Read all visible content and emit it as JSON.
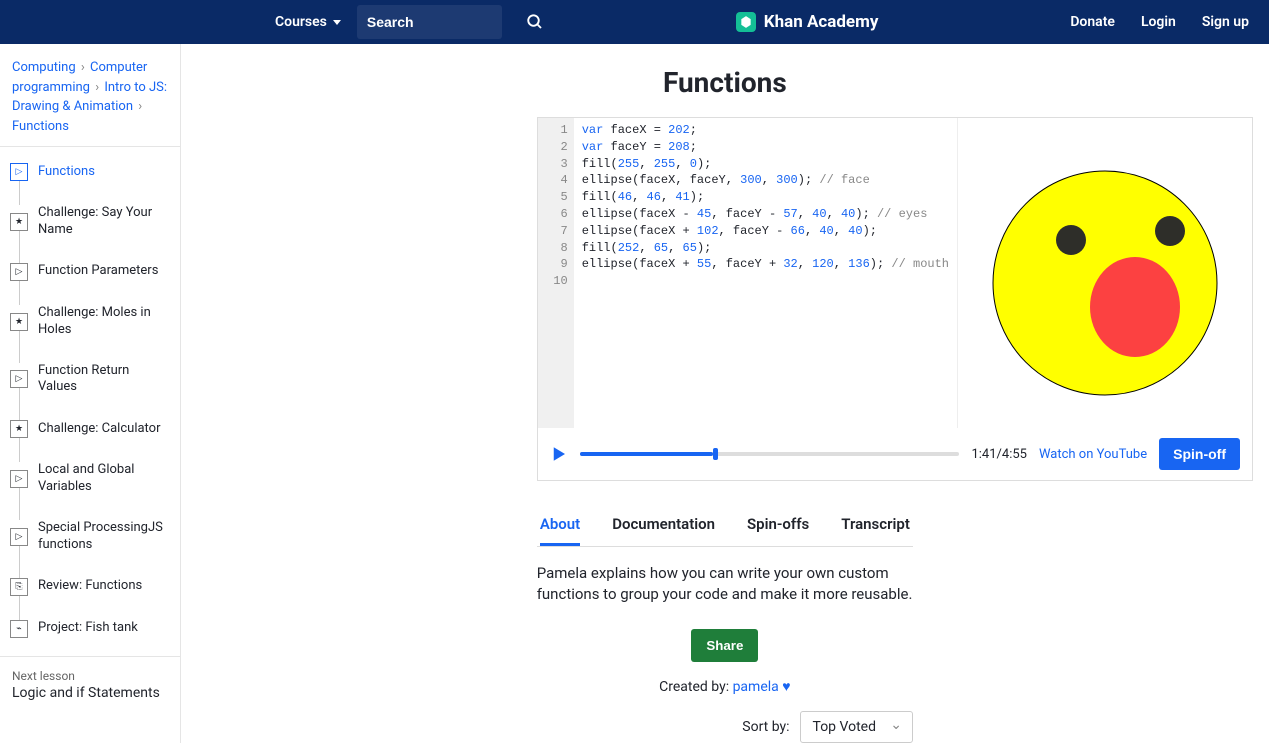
{
  "header": {
    "courses": "Courses",
    "search_placeholder": "Search",
    "brand": "Khan Academy",
    "donate": "Donate",
    "login": "Login",
    "signup": "Sign up"
  },
  "breadcrumb": {
    "a": "Computing",
    "b": "Computer programming",
    "c": "Intro to JS: Drawing & Animation",
    "d": "Functions"
  },
  "lessons": [
    {
      "label": "Functions",
      "icon": "play",
      "active": true
    },
    {
      "label": "Challenge: Say Your Name",
      "icon": "star"
    },
    {
      "label": "Function Parameters",
      "icon": "play"
    },
    {
      "label": "Challenge: Moles in Holes",
      "icon": "star"
    },
    {
      "label": "Function Return Values",
      "icon": "play"
    },
    {
      "label": "Challenge: Calculator",
      "icon": "star"
    },
    {
      "label": "Local and Global Variables",
      "icon": "play"
    },
    {
      "label": "Special ProcessingJS functions",
      "icon": "play"
    },
    {
      "label": "Review: Functions",
      "icon": "doc"
    },
    {
      "label": "Project: Fish tank",
      "icon": "project"
    }
  ],
  "next_lesson": {
    "label": "Next lesson",
    "title": "Logic and if Statements"
  },
  "page_title": "Functions",
  "code": {
    "lines": [
      "var faceX = 202;",
      "var faceY = 208;",
      "fill(255, 255, 0);",
      "ellipse(faceX, faceY, 300, 300); // face",
      "fill(46, 46, 41);",
      "ellipse(faceX - 45, faceY - 57, 40, 40); // eyes",
      "ellipse(faceX + 102, faceY - 66, 40, 40);",
      "fill(252, 65, 65);",
      "ellipse(faceX + 55, faceY + 32, 120, 136); // mouth",
      ""
    ]
  },
  "controls": {
    "time": "1:41/4:55",
    "watch": "Watch on YouTube",
    "spinoff": "Spin-off"
  },
  "tabs": [
    "About",
    "Documentation",
    "Spin-offs",
    "Transcript"
  ],
  "active_tab": 0,
  "description": "Pamela explains how you can write your own custom functions to group your code and make it more reusable.",
  "share": "Share",
  "created_label": "Created by: ",
  "creator": "pamela",
  "sort": {
    "label": "Sort by:",
    "value": "Top Voted"
  }
}
